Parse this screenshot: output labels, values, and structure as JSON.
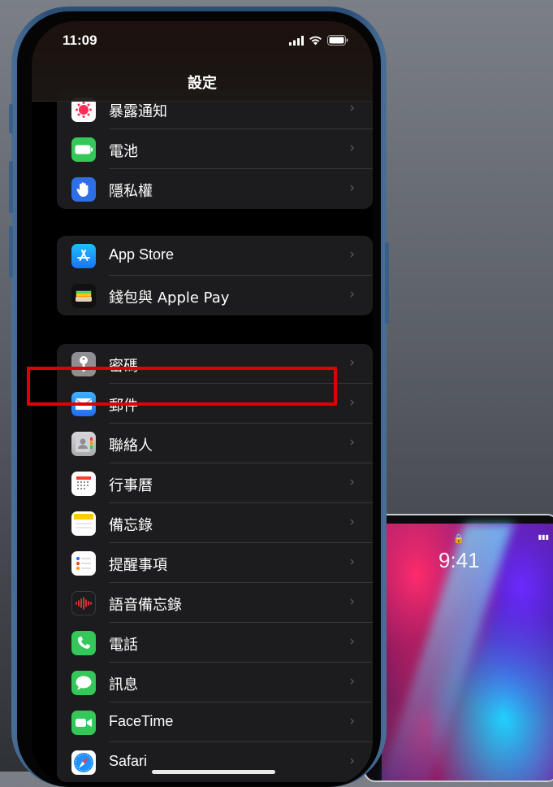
{
  "status_bar": {
    "time": "11:09"
  },
  "nav": {
    "title": "設定"
  },
  "groups": [
    {
      "rows": [
        {
          "label": "暴露通知",
          "icon": "exposure-notification-icon",
          "color": "#ffffff"
        },
        {
          "label": "電池",
          "icon": "battery-icon",
          "color": "#34c759"
        },
        {
          "label": "隱私權",
          "icon": "hand-icon",
          "color": "#2f6fe6"
        }
      ]
    },
    {
      "rows": [
        {
          "label": "App Store",
          "icon": "app-store-icon",
          "color": "#1b8cf5"
        },
        {
          "label": "錢包與 Apple Pay",
          "icon": "wallet-icon",
          "color": "#111111"
        }
      ]
    },
    {
      "rows": [
        {
          "label": "密碼",
          "icon": "key-icon",
          "color": "#8e8e93"
        },
        {
          "label": "郵件",
          "icon": "mail-icon",
          "color": "#2f86f5",
          "highlighted": true
        },
        {
          "label": "聯絡人",
          "icon": "contacts-icon",
          "color": "#c7c7cc"
        },
        {
          "label": "行事曆",
          "icon": "calendar-icon",
          "color": "#ffffff"
        },
        {
          "label": "備忘錄",
          "icon": "notes-icon",
          "color": "#ffffff"
        },
        {
          "label": "提醒事項",
          "icon": "reminders-icon",
          "color": "#ffffff"
        },
        {
          "label": "語音備忘錄",
          "icon": "voice-memos-icon",
          "color": "#1c1c1e"
        },
        {
          "label": "電話",
          "icon": "phone-icon",
          "color": "#34c759"
        },
        {
          "label": "訊息",
          "icon": "messages-icon",
          "color": "#34c759"
        },
        {
          "label": "FaceTime",
          "icon": "facetime-icon",
          "color": "#34c759"
        },
        {
          "label": "Safari",
          "icon": "safari-icon",
          "color": "#1e90ff"
        }
      ]
    }
  ],
  "ipad": {
    "time": "9:41"
  }
}
